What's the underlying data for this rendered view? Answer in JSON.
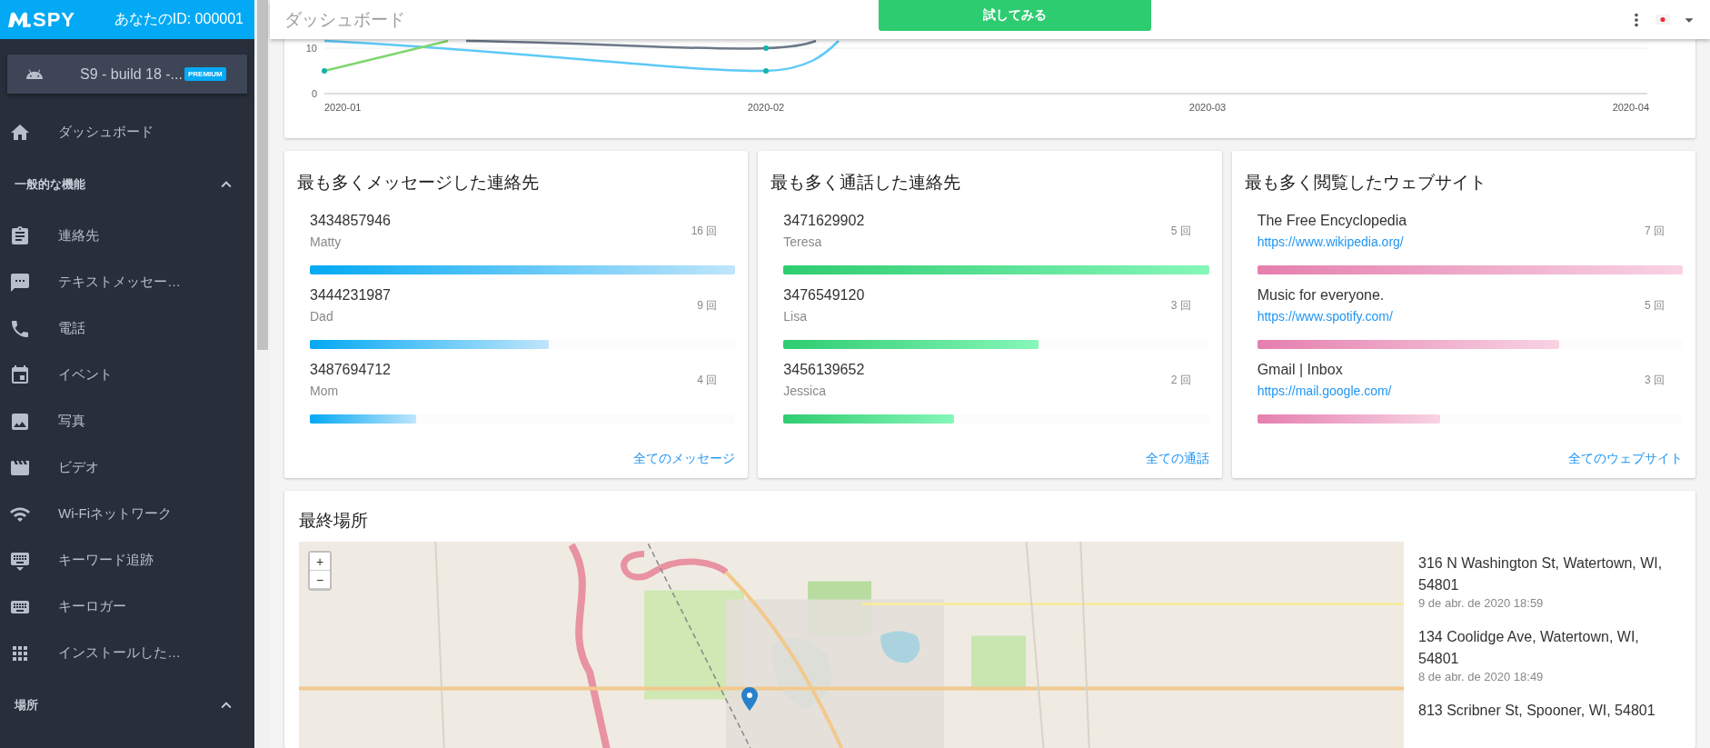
{
  "app": {
    "logo": "SPY",
    "user_id": "あなたのID: 000001"
  },
  "device": {
    "name": "S9 - build 18 -...",
    "badge": "PREMIUM"
  },
  "sidebar": {
    "top_items": [
      {
        "label": "ダッシュボード"
      }
    ],
    "sections": [
      {
        "label": "一般的な機能",
        "expanded": true,
        "items": [
          {
            "label": "連絡先"
          },
          {
            "label": "テキストメッセー…"
          },
          {
            "label": "電話"
          },
          {
            "label": "イベント"
          },
          {
            "label": "写真"
          },
          {
            "label": "ビデオ"
          },
          {
            "label": "Wi-Fiネットワーク"
          },
          {
            "label": "キーワード追跡"
          },
          {
            "label": "キーロガー"
          },
          {
            "label": "インストールした…"
          }
        ]
      },
      {
        "label": "場所",
        "expanded": true
      }
    ]
  },
  "topbar": {
    "title": "ダッシュボード",
    "try_button": "試してみる"
  },
  "activity_chart": {
    "x_labels": [
      "2020-01",
      "2020-02",
      "2020-03",
      "2020-04"
    ],
    "y_labels": [
      "10",
      "0"
    ]
  },
  "cards": [
    {
      "kind": "messages",
      "title": "最も多くメッセージした連絡先",
      "footer_link": "全てのメッセージ",
      "items": [
        {
          "primary": "3434857946",
          "secondary": "Matty",
          "count": "16 回",
          "level": 1
        },
        {
          "primary": "3444231987",
          "secondary": "Dad",
          "count": "9 回",
          "level": 0.5625
        },
        {
          "primary": "3487694712",
          "secondary": "Mom",
          "count": "4 回",
          "level": 0.25
        }
      ]
    },
    {
      "kind": "calls",
      "title": "最も多く通話した連絡先",
      "footer_link": "全ての通話",
      "items": [
        {
          "primary": "3471629902",
          "secondary": "Teresa",
          "count": "5 回",
          "level": 1
        },
        {
          "primary": "3476549120",
          "secondary": "Lisa",
          "count": "3 回",
          "level": 0.6
        },
        {
          "primary": "3456139652",
          "secondary": "Jessica",
          "count": "2 回",
          "level": 0.4
        }
      ]
    },
    {
      "kind": "websites",
      "title": "最も多く閲覧したウェブサイト",
      "footer_link": "全てのウェブサイト",
      "items": [
        {
          "primary": "The Free Encyclopedia",
          "secondary": "https://www.wikipedia.org/",
          "count": "7 回",
          "level": 1
        },
        {
          "primary": "Music for everyone.",
          "secondary": "https://www.spotify.com/",
          "count": "5 回",
          "level": 0.71
        },
        {
          "primary": "Gmail | Inbox",
          "secondary": "https://mail.google.com/",
          "count": "3 回",
          "level": 0.43
        }
      ]
    }
  ],
  "last_location": {
    "title": "最終場所",
    "map": {
      "kind": "picture",
      "zoom_in": "+",
      "zoom_out": "−"
    },
    "locations": [
      {
        "address": "316 N Washington St, Watertown, WI, 54801",
        "time": "9 de abr. de 2020 18:59"
      },
      {
        "address": "134 Coolidge Ave, Watertown, WI, 54801",
        "time": "8 de abr. de 2020 18:49"
      },
      {
        "address": "813 Scribner St, Spooner, WI, 54801"
      }
    ]
  }
}
